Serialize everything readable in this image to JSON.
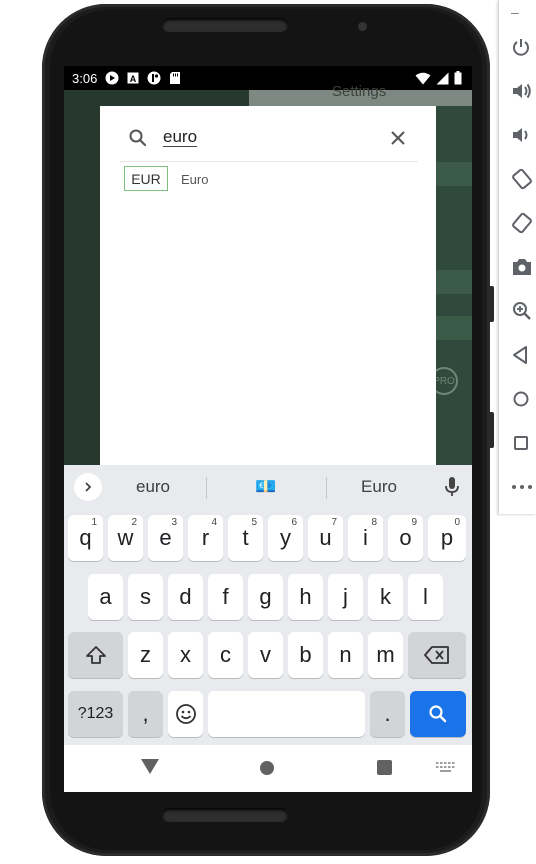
{
  "status_bar": {
    "time": "3:06",
    "icons": [
      "play-icon",
      "a-icon",
      "tracker-icon",
      "sd-card-icon",
      "wifi-icon",
      "signal-icon",
      "battery-icon"
    ]
  },
  "background_app": {
    "title": "Settings",
    "badge": "PRO"
  },
  "dialog": {
    "search": {
      "value": "euro",
      "icon": "search-icon",
      "clear_icon": "close-icon"
    },
    "results": [
      {
        "code": "EUR",
        "name": "Euro"
      }
    ]
  },
  "keyboard": {
    "suggestions": [
      "euro",
      "💶",
      "Euro"
    ],
    "rows": [
      [
        {
          "label": "q",
          "hint": "1"
        },
        {
          "label": "w",
          "hint": "2"
        },
        {
          "label": "e",
          "hint": "3"
        },
        {
          "label": "r",
          "hint": "4"
        },
        {
          "label": "t",
          "hint": "5"
        },
        {
          "label": "y",
          "hint": "6"
        },
        {
          "label": "u",
          "hint": "7"
        },
        {
          "label": "i",
          "hint": "8"
        },
        {
          "label": "o",
          "hint": "9"
        },
        {
          "label": "p",
          "hint": "0"
        }
      ],
      [
        {
          "label": "a"
        },
        {
          "label": "s"
        },
        {
          "label": "d"
        },
        {
          "label": "f"
        },
        {
          "label": "g"
        },
        {
          "label": "h"
        },
        {
          "label": "j"
        },
        {
          "label": "k"
        },
        {
          "label": "l"
        }
      ],
      [
        {
          "label": "z"
        },
        {
          "label": "x"
        },
        {
          "label": "c"
        },
        {
          "label": "v"
        },
        {
          "label": "b"
        },
        {
          "label": "n"
        },
        {
          "label": "m"
        }
      ]
    ],
    "symbols_label": "?123",
    "comma_label": ",",
    "period_label": ".",
    "shift_icon": "shift-icon",
    "backspace_icon": "backspace-icon",
    "emoji_icon": "emoji-icon",
    "search_action_icon": "search-icon",
    "mic_icon": "mic-icon",
    "expand_icon": "chevron-right-icon"
  },
  "nav_bar": {
    "icons": [
      "back-icon",
      "home-icon",
      "recents-icon",
      "keyboard-switch-icon"
    ]
  },
  "emulator_toolbar": {
    "minimize_label": "–",
    "icons": [
      "power-icon",
      "volume-up-icon",
      "volume-down-icon",
      "rotate-left-icon",
      "rotate-right-icon",
      "screenshot-icon",
      "zoom-icon",
      "back-icon",
      "home-icon",
      "overview-icon",
      "more-icon"
    ]
  },
  "colors": {
    "accent": "#1a73e8",
    "badge_border": "#7fbf7f",
    "keyboard_bg": "#e8eaed"
  }
}
